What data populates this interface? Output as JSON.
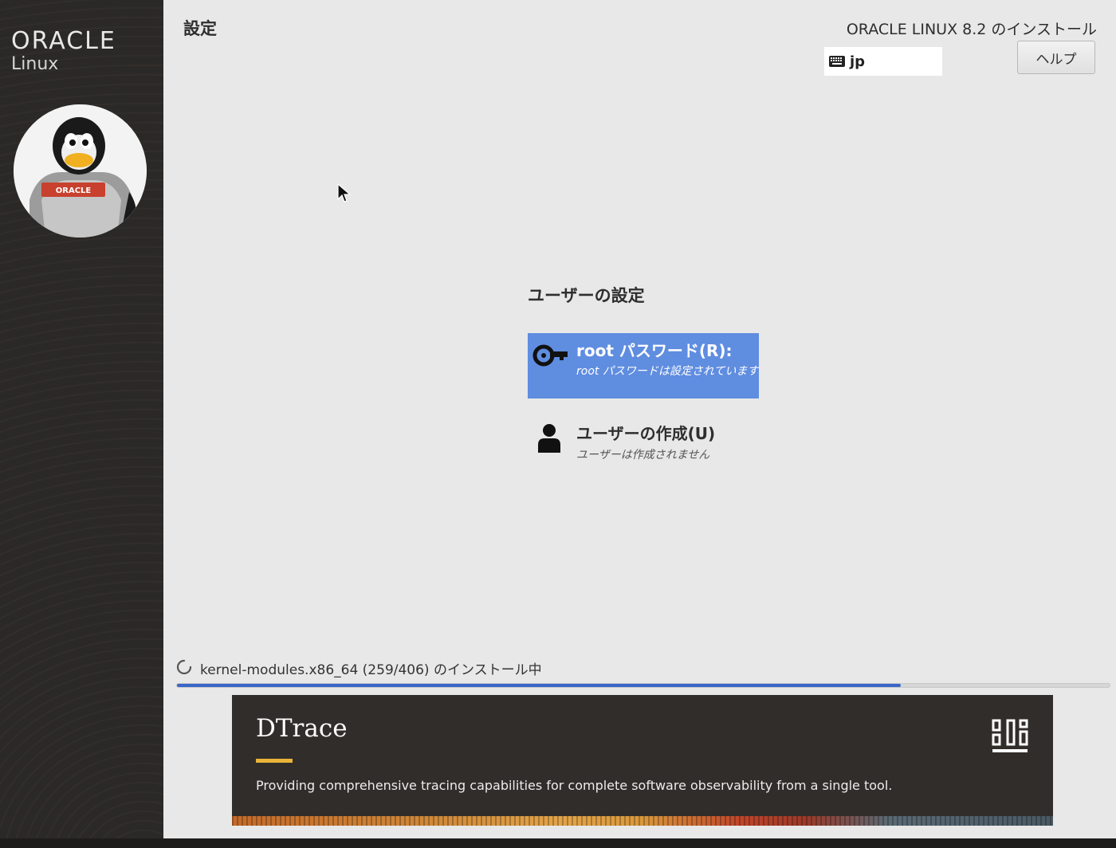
{
  "sidebar": {
    "brand": "ORACLE",
    "brand_sub": "Linux",
    "mascot_label": "ORACLE"
  },
  "header": {
    "page_title": "設定",
    "product_title": "ORACLE LINUX 8.2 のインストール",
    "keyboard_layout": "jp",
    "help_label": "ヘルプ"
  },
  "user_settings": {
    "section_title": "ユーザーの設定",
    "spokes": [
      {
        "title": "root パスワード(R):",
        "status": "root パスワードは設定されています",
        "icon": "key-icon",
        "selected": true
      },
      {
        "title": "ユーザーの作成(U)",
        "status": "ユーザーは作成されません",
        "icon": "user-icon",
        "selected": false
      }
    ]
  },
  "progress": {
    "label": "kernel-modules.x86_64 (259/406) のインストール中",
    "fraction": 0.776
  },
  "banner": {
    "title": "DTrace",
    "description": "Providing comprehensive tracing capabilities for complete software observability from a single tool.",
    "accent_color": "#e9b43a"
  },
  "colors": {
    "selected_spoke": "#5f8de0",
    "progress": "#3b66c8",
    "sidebar": "#2b2927",
    "main_bg": "#e8e8e8"
  }
}
